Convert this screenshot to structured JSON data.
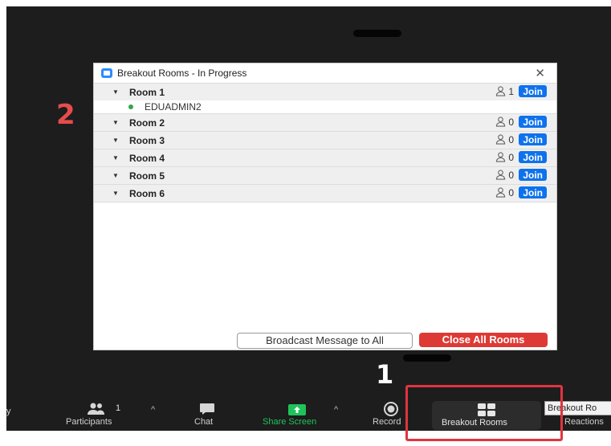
{
  "annotations": {
    "step1": "1",
    "step2": "2"
  },
  "dialog": {
    "title": "Breakout Rooms - In Progress",
    "close_icon": "close-icon",
    "rooms": [
      {
        "name": "Room 1",
        "count": "1",
        "join": "Join",
        "members": [
          "EDUADMIN2"
        ]
      },
      {
        "name": "Room 2",
        "count": "0",
        "join": "Join"
      },
      {
        "name": "Room 3",
        "count": "0",
        "join": "Join"
      },
      {
        "name": "Room 4",
        "count": "0",
        "join": "Join"
      },
      {
        "name": "Room 5",
        "count": "0",
        "join": "Join"
      },
      {
        "name": "Room 6",
        "count": "0",
        "join": "Join"
      }
    ],
    "broadcast_label": "Broadcast Message to All",
    "close_all_label": "Close All Rooms"
  },
  "toolbar": {
    "left_cut_label": "y",
    "participants": {
      "label": "Participants",
      "count": "1"
    },
    "chat": {
      "label": "Chat"
    },
    "share": {
      "label": "Share Screen"
    },
    "record": {
      "label": "Record"
    },
    "breakout": {
      "label": "Breakout Rooms",
      "tooltip": "Breakout Ro"
    },
    "reactions": {
      "label": "Reactions"
    }
  },
  "colors": {
    "accent": "#0e72ed",
    "danger": "#dd3a35",
    "share_green": "#1fc35a",
    "annotation_red": "#e0343e"
  }
}
